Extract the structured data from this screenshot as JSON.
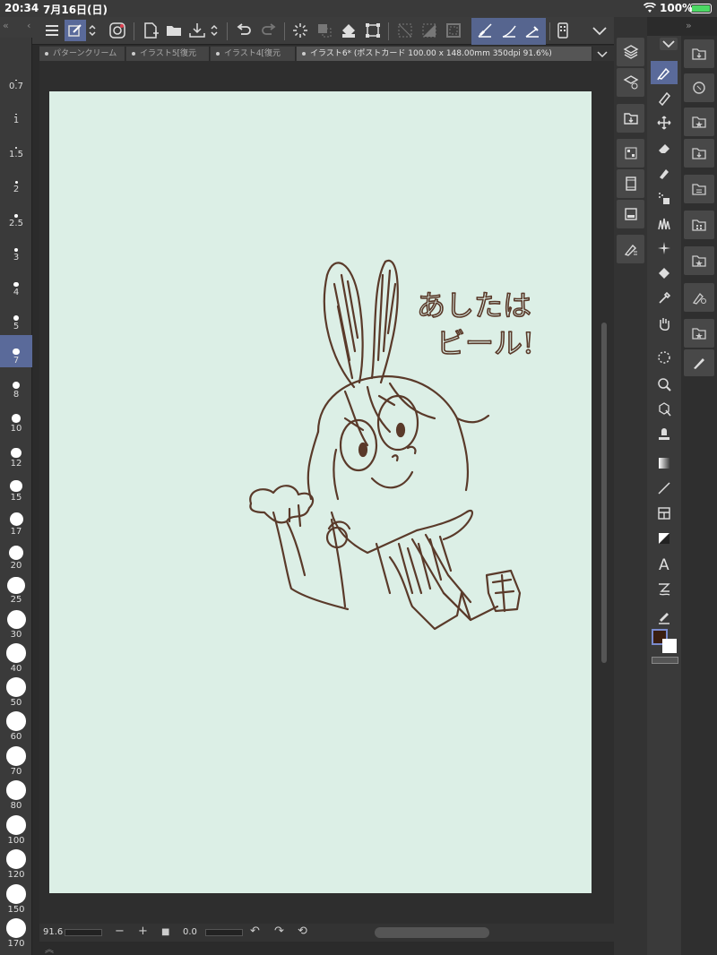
{
  "status_bar": {
    "time": "20:34",
    "date": "7月16日(日)",
    "battery_percent": "100%",
    "battery_color": "#4cd964"
  },
  "tabs": [
    {
      "label": "パターンクリーム"
    },
    {
      "label": "イラスト5[復元"
    },
    {
      "label": "イラスト4[復元"
    },
    {
      "label": "イラスト6* (ポストカード 100.00 x 148.00mm 350dpi 91.6%)",
      "active": true
    }
  ],
  "brush_sizes": [
    {
      "label": "0.7"
    },
    {
      "label": "1"
    },
    {
      "label": "1.5"
    },
    {
      "label": "2"
    },
    {
      "label": "2.5"
    },
    {
      "label": "3"
    },
    {
      "label": "4"
    },
    {
      "label": "5"
    },
    {
      "label": "7",
      "active": true
    },
    {
      "label": "8"
    },
    {
      "label": "10"
    },
    {
      "label": "12"
    },
    {
      "label": "15"
    },
    {
      "label": "17"
    },
    {
      "label": "20"
    },
    {
      "label": "25"
    },
    {
      "label": "30"
    },
    {
      "label": "40"
    },
    {
      "label": "50"
    },
    {
      "label": "60"
    },
    {
      "label": "70"
    },
    {
      "label": "80"
    },
    {
      "label": "100"
    },
    {
      "label": "120"
    },
    {
      "label": "150"
    },
    {
      "label": "170"
    }
  ],
  "canvas": {
    "background_color": "#dcefe6",
    "line_color": "#5a3a2a",
    "handwriting_line1": "あしたは",
    "handwriting_line2": "ビール!"
  },
  "bottom_bar": {
    "zoom": "91.6",
    "rotation": "0.0"
  },
  "colors": {
    "main": "#3a1e10",
    "sub": "#ffffff",
    "accent": "#5a6a9a"
  }
}
